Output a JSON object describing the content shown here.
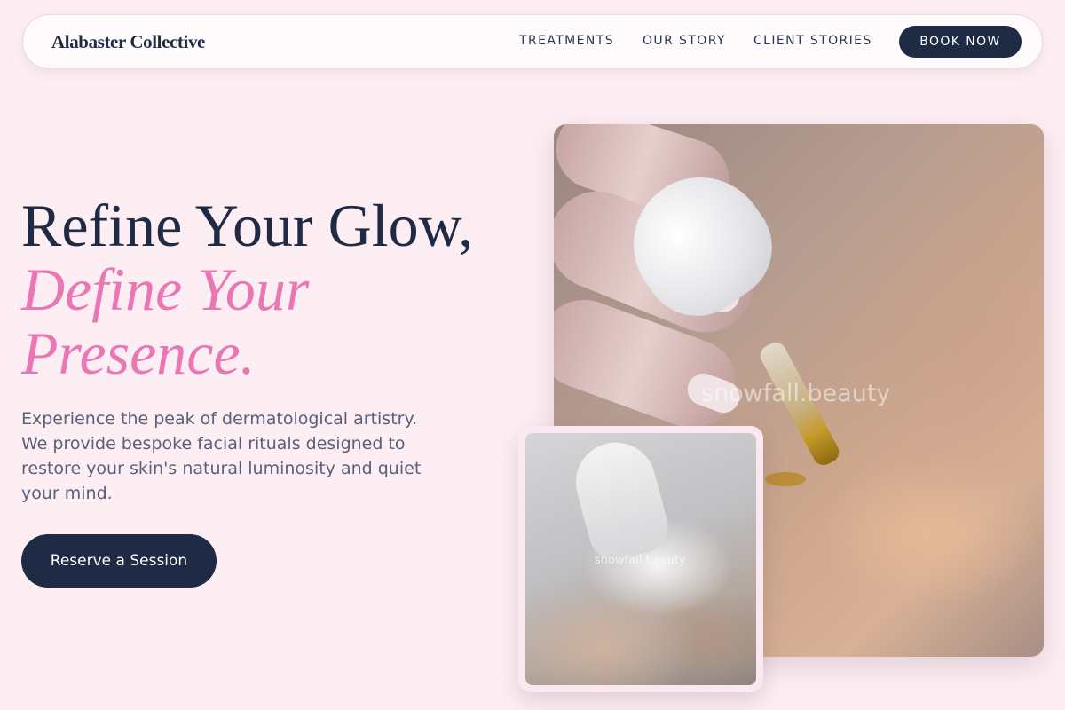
{
  "brand": {
    "name": "Alabaster Collective"
  },
  "nav": {
    "links": [
      "TREATMENTS",
      "OUR STORY",
      "CLIENT STORIES"
    ],
    "cta": "BOOK NOW"
  },
  "hero": {
    "headline_line1": "Refine Your Glow,",
    "headline_line2": "Define Your",
    "headline_line3": "Presence.",
    "description": "Experience the peak of dermatological artistry. We provide bespoke facial rituals designed to restore your skin's natural luminosity and quiet your mind.",
    "cta": "Reserve a Session"
  },
  "images": {
    "main_watermark": "snowfall.beauty",
    "secondary_watermark": "snowfall.beauty"
  },
  "colors": {
    "background": "#fdeef4",
    "navy": "#1f2a44",
    "accent_pink": "#ea76b3"
  }
}
